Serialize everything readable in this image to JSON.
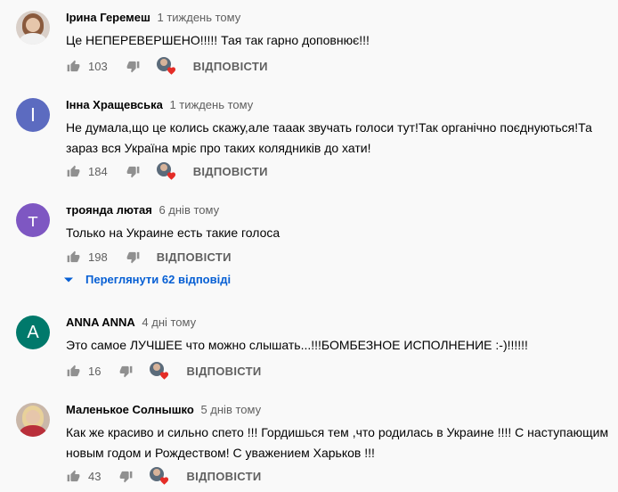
{
  "colors": {
    "background": "#f9f9f9",
    "link": "#065fd4",
    "avatar_purple": "#5c6bc0",
    "avatar_violet": "#7e57c2",
    "avatar_teal": "#00796b",
    "heart": "#e52d27"
  },
  "comments": [
    {
      "author": "Ірина Геремеш",
      "time": "1 тиждень тому",
      "avatar": "photo",
      "text": "Це НЕПЕРЕВЕРШЕНО!!!!! Тая так гарно доповнює!!!",
      "likes": "103",
      "creator_heart": true,
      "reply_label": "ВІДПОВІСТИ"
    },
    {
      "author": "Інна Хращевська",
      "time": "1 тиждень тому",
      "avatar": "І",
      "text": "Не думала,що це колись скажу,але тааак  звучать голоси тут!Так органічно поєднуються!Та зараз вся Україна мріє про таких колядників до хати!",
      "likes": "184",
      "creator_heart": true,
      "reply_label": "ВІДПОВІСТИ"
    },
    {
      "author": "троянда лютая",
      "time": "6 днів тому",
      "avatar": "т",
      "text": "Только на Украине есть такие голоса",
      "likes": "198",
      "creator_heart": false,
      "reply_label": "ВІДПОВІСТИ",
      "view_replies": "Переглянути 62 відповіді"
    },
    {
      "author": "ANNA ANNA",
      "time": "4 дні тому",
      "avatar": "A",
      "text": "Это самое ЛУЧШЕЕ что можно слышать...!!!БОМБЕЗНОЕ ИСПОЛНЕНИЕ :-)!!!!!!",
      "likes": "16",
      "creator_heart": true,
      "reply_label": "ВІДПОВІСТИ"
    },
    {
      "author": "Маленькое Солнышко",
      "time": "5 днів тому",
      "avatar": "photo",
      "text": "Как же красиво и сильно спето !!! Гордишься тем ,что родилась в Украине !!!! С наступающим новым годом и Рождеством! С уважением Харьков !!!",
      "likes": "43",
      "creator_heart": true,
      "reply_label": "ВІДПОВІСТИ"
    }
  ]
}
